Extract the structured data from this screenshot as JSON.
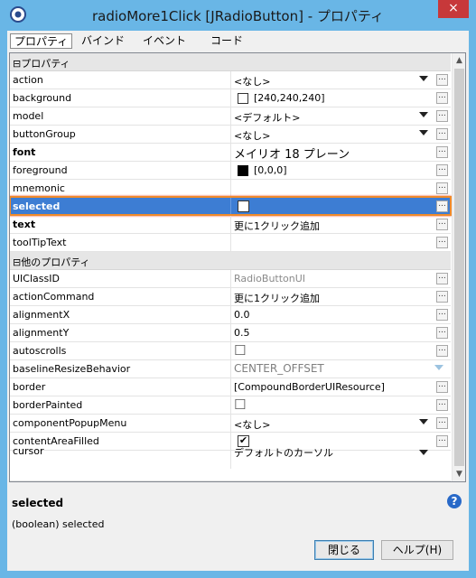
{
  "window": {
    "title": "radioMore1Click [JRadioButton] - プロパティ",
    "close_glyph": "×"
  },
  "tabs": [
    "プロパティ",
    "バインド",
    "イベント",
    "コード"
  ],
  "categories": {
    "props": "⊟プロパティ",
    "other": "⊟他のプロパティ"
  },
  "rows": [
    {
      "name": "action",
      "value": "<なし>",
      "dd": true
    },
    {
      "name": "background",
      "value": "[240,240,240]",
      "swatch": "#ffffff"
    },
    {
      "name": "model",
      "value": "<デフォルト>",
      "dd": true
    },
    {
      "name": "buttonGroup",
      "value": "<なし>",
      "dd": true
    },
    {
      "name": "font",
      "value": "メイリオ 18 プレーン",
      "bold": true
    },
    {
      "name": "foreground",
      "value": "[0,0,0]",
      "swatch": "#000000"
    },
    {
      "name": "mnemonic",
      "value": ""
    },
    {
      "name": "selected",
      "value": "✔",
      "selected": true
    },
    {
      "name": "text",
      "value": "更に1クリック追加",
      "bold": true
    },
    {
      "name": "toolTipText",
      "value": ""
    }
  ],
  "other_rows": [
    {
      "name": "UIClassID",
      "value": "RadioButtonUI"
    },
    {
      "name": "actionCommand",
      "value": "更に1クリック追加"
    },
    {
      "name": "alignmentX",
      "value": "0.0"
    },
    {
      "name": "alignmentY",
      "value": "0.5"
    },
    {
      "name": "autoscrolls",
      "value": "☐"
    },
    {
      "name": "baselineResizeBehavior",
      "value": "CENTER_OFFSET"
    },
    {
      "name": "border",
      "value": "[CompoundBorderUIResource]"
    },
    {
      "name": "borderPainted",
      "value": "☐"
    },
    {
      "name": "componentPopupMenu",
      "value": "<なし>"
    },
    {
      "name": "contentAreaFilled",
      "value": "✔"
    },
    {
      "name": "cursor",
      "value": "デフォルトのカーソル"
    }
  ],
  "ellipsis": "...",
  "description": {
    "title": "selected",
    "text": "(boolean) selected",
    "help_glyph": "?"
  },
  "buttons": {
    "close": "閉じる",
    "help": "ヘルプ(H)"
  },
  "colors": {
    "title_bar": "#69b6e6",
    "selection": "#3d7dd3",
    "highlight_ring": "#f08a2a",
    "close_button": "#c7383a"
  }
}
